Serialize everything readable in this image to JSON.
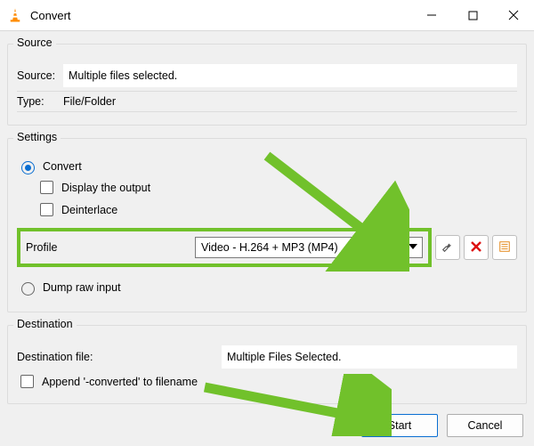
{
  "window": {
    "title": "Convert"
  },
  "source": {
    "legend": "Source",
    "source_label": "Source:",
    "source_value": "Multiple files selected.",
    "type_label": "Type:",
    "type_value": "File/Folder"
  },
  "settings": {
    "legend": "Settings",
    "convert_label": "Convert",
    "display_output_label": "Display the output",
    "deinterlace_label": "Deinterlace",
    "profile_label": "Profile",
    "profile_value": "Video - H.264 + MP3 (MP4)",
    "dump_label": "Dump raw input"
  },
  "destination": {
    "legend": "Destination",
    "file_label": "Destination file:",
    "file_value": "Multiple Files Selected.",
    "append_label": "Append '-converted' to filename"
  },
  "footer": {
    "start_label": "Start",
    "cancel_label": "Cancel"
  },
  "colors": {
    "highlight": "#71c12b",
    "accent": "#0a6ed1"
  }
}
